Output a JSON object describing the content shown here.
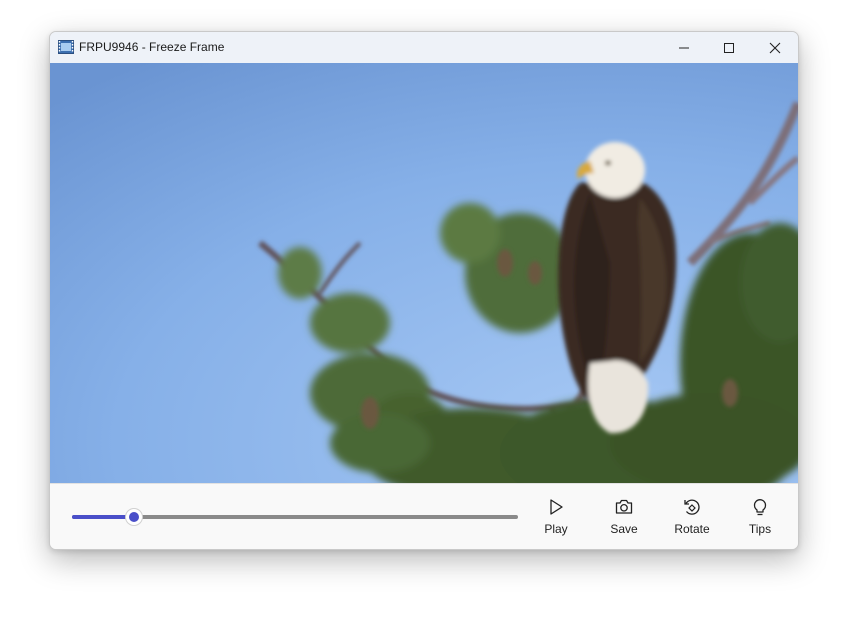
{
  "window": {
    "title": "FRPU9946 - Freeze Frame",
    "icons": {
      "app": "film-strip-icon",
      "minimize": "minimize-icon",
      "maximize": "maximize-icon",
      "close": "close-icon"
    }
  },
  "viewer": {
    "image_subject": "bald eagle perched on a pine branch against a blue sky"
  },
  "controls": {
    "seek_position": 0.14,
    "accent_color": "#4a4fc9",
    "play_label": "Play",
    "save_label": "Save",
    "rotate_label": "Rotate",
    "tips_label": "Tips",
    "icons": {
      "play": "play-icon",
      "save": "camera-icon",
      "rotate": "rotate-icon",
      "tips": "lightbulb-icon"
    }
  }
}
